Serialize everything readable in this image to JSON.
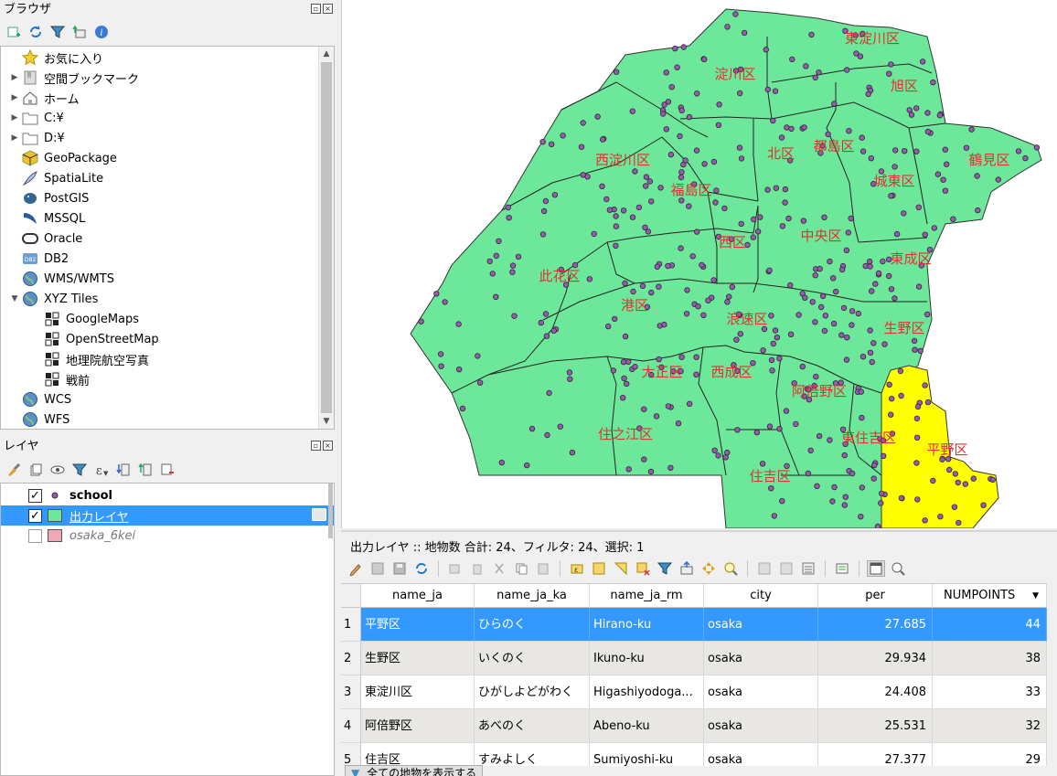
{
  "browser": {
    "title": "ブラウザ",
    "items": [
      {
        "label": "お気に入り",
        "icon": "star-icon",
        "arrow": ""
      },
      {
        "label": "空間ブックマーク",
        "icon": "bookmark-icon",
        "arrow": "▶"
      },
      {
        "label": "ホーム",
        "icon": "home-icon",
        "arrow": "▶"
      },
      {
        "label": "C:¥",
        "icon": "folder-icon",
        "arrow": "▶"
      },
      {
        "label": "D:¥",
        "icon": "folder-icon",
        "arrow": "▶"
      },
      {
        "label": "GeoPackage",
        "icon": "geopackage-icon",
        "arrow": ""
      },
      {
        "label": "SpatiaLite",
        "icon": "spatialite-icon",
        "arrow": ""
      },
      {
        "label": "PostGIS",
        "icon": "postgis-icon",
        "arrow": ""
      },
      {
        "label": "MSSQL",
        "icon": "mssql-icon",
        "arrow": ""
      },
      {
        "label": "Oracle",
        "icon": "oracle-icon",
        "arrow": ""
      },
      {
        "label": "DB2",
        "icon": "db2-icon",
        "arrow": ""
      },
      {
        "label": "WMS/WMTS",
        "icon": "globe-icon",
        "arrow": ""
      },
      {
        "label": "XYZ Tiles",
        "icon": "globe-icon",
        "arrow": "▼"
      },
      {
        "label": "GoogleMaps",
        "icon": "tiles-icon",
        "arrow": ""
      },
      {
        "label": "OpenStreetMap",
        "icon": "tiles-icon",
        "arrow": ""
      },
      {
        "label": "地理院航空写真",
        "icon": "tiles-icon",
        "arrow": ""
      },
      {
        "label": "戦前",
        "icon": "tiles-icon",
        "arrow": ""
      },
      {
        "label": "WCS",
        "icon": "globe-icon",
        "arrow": ""
      },
      {
        "label": "WFS",
        "icon": "globe-icon",
        "arrow": ""
      }
    ]
  },
  "layers": {
    "title": "レイヤ",
    "items": [
      {
        "label": "school",
        "checked": "✓"
      },
      {
        "label": "出力レイヤ",
        "checked": "✓"
      },
      {
        "label": "osaka_6kei",
        "checked": ""
      }
    ]
  },
  "map": {
    "wards": [
      "東淀川区",
      "淀川区",
      "旭区",
      "西淀川区",
      "北区",
      "都島区",
      "鶴見区",
      "城東区",
      "福島区",
      "西区",
      "中央区",
      "東成区",
      "此花区",
      "港区",
      "浪速区",
      "生野区",
      "大正区",
      "西成区",
      "阿倍野区",
      "住之江区",
      "東住吉区",
      "平野区",
      "住吉区"
    ],
    "colors": {
      "ward_fill": "#6de89a",
      "selected_fill": "#ffff00",
      "point_fill": "#9b59b6",
      "label": "#e03131"
    }
  },
  "attribute_table": {
    "title": "出力レイヤ :: 地物数 合計: 24、フィルタ: 24、選択: 1",
    "columns": [
      "name_ja",
      "name_ja_ka",
      "name_ja_rm",
      "city",
      "per",
      "NUMPOINTS"
    ],
    "sort_indicator": "▼",
    "rows": [
      {
        "n": "1",
        "name_ja": "平野区",
        "name_ja_ka": "ひらのく",
        "name_ja_rm": "Hirano-ku",
        "city": "osaka",
        "per": "27.685",
        "NUMPOINTS": "44"
      },
      {
        "n": "2",
        "name_ja": "生野区",
        "name_ja_ka": "いくのく",
        "name_ja_rm": "Ikuno-ku",
        "city": "osaka",
        "per": "29.934",
        "NUMPOINTS": "38"
      },
      {
        "n": "3",
        "name_ja": "東淀川区",
        "name_ja_ka": "ひがしよどがわく",
        "name_ja_rm": "Higashiyodoga...",
        "city": "osaka",
        "per": "24.408",
        "NUMPOINTS": "33"
      },
      {
        "n": "4",
        "name_ja": "阿倍野区",
        "name_ja_ka": "あべのく",
        "name_ja_rm": "Abeno-ku",
        "city": "osaka",
        "per": "25.531",
        "NUMPOINTS": "32"
      },
      {
        "n": "5",
        "name_ja": "住吉区",
        "name_ja_ka": "すみよしく",
        "name_ja_rm": "Sumiyoshi-ku",
        "city": "osaka",
        "per": "27.377",
        "NUMPOINTS": "29"
      }
    ],
    "filter_button": "全ての地物を表示する"
  }
}
